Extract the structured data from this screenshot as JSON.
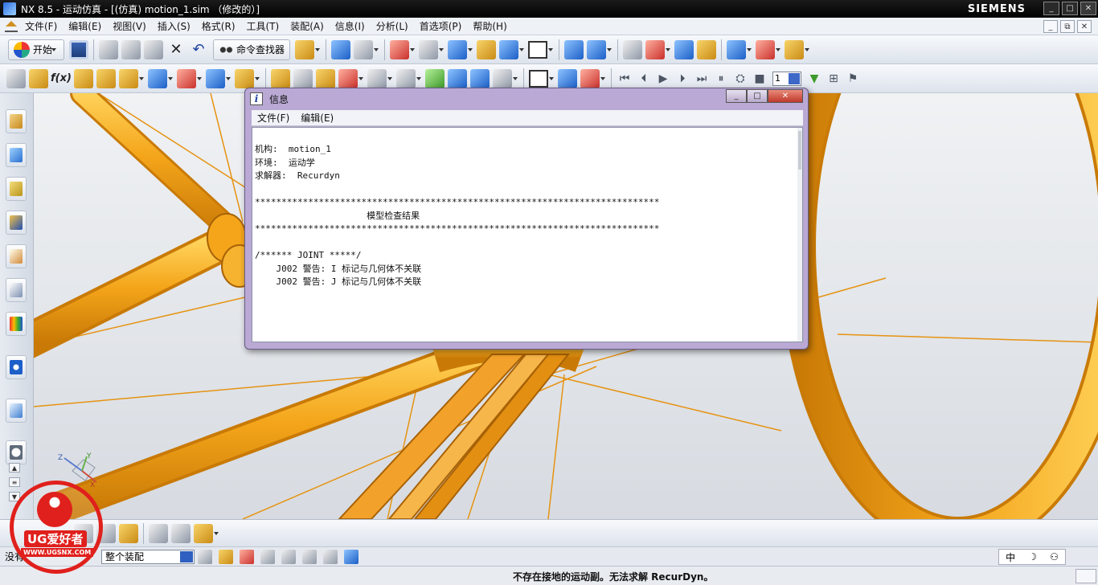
{
  "window": {
    "title": "NX 8.5 - 运动仿真 - [(仿真) motion_1.sim （修改的）]",
    "brand": "SIEMENS",
    "controls": [
      "_",
      "□",
      "✕"
    ]
  },
  "menubar": {
    "items": [
      "文件(F)",
      "编辑(E)",
      "视图(V)",
      "插入(S)",
      "格式(R)",
      "工具(T)",
      "装配(A)",
      "信息(I)",
      "分析(L)",
      "首选项(P)",
      "帮助(H)"
    ],
    "doc_controls": [
      "_",
      "⧉",
      "✕"
    ]
  },
  "toolbar1": {
    "start_label": "开始",
    "command_finder_label": "命令查找器"
  },
  "toolbar2": {
    "fx_label": "f(x)",
    "step_value": "1"
  },
  "info_dialog": {
    "title": "信息",
    "menu": [
      "文件(F)",
      "编辑(E)"
    ],
    "text": "机构:  motion_1\n环境:  运动学\n求解器:  Recurdyn\n\n****************************************************************************\n                     模型检查结果\n****************************************************************************\n\n/****** JOINT *****/\n    J002 警告: I 标记与几何体不关联\n    J002 警告: J 标记与几何体不关联"
  },
  "selection_bar": {
    "filter_label": "没有",
    "scope_value": "整个装配"
  },
  "ime": [
    "中",
    "☽",
    "⚇"
  ],
  "status": {
    "message": "不存在接地的运动副。无法求解 RecurDyn。"
  },
  "watermark": {
    "name": "UG爱好者",
    "url": "WWW.UGSNX.COM"
  },
  "triad_labels": [
    "Z",
    "Y",
    "X"
  ],
  "colors": {
    "tube": "#f4a51a",
    "tube_dark": "#c97a06",
    "tube_light": "#ffd25a",
    "accent_red": "#e0201c"
  }
}
